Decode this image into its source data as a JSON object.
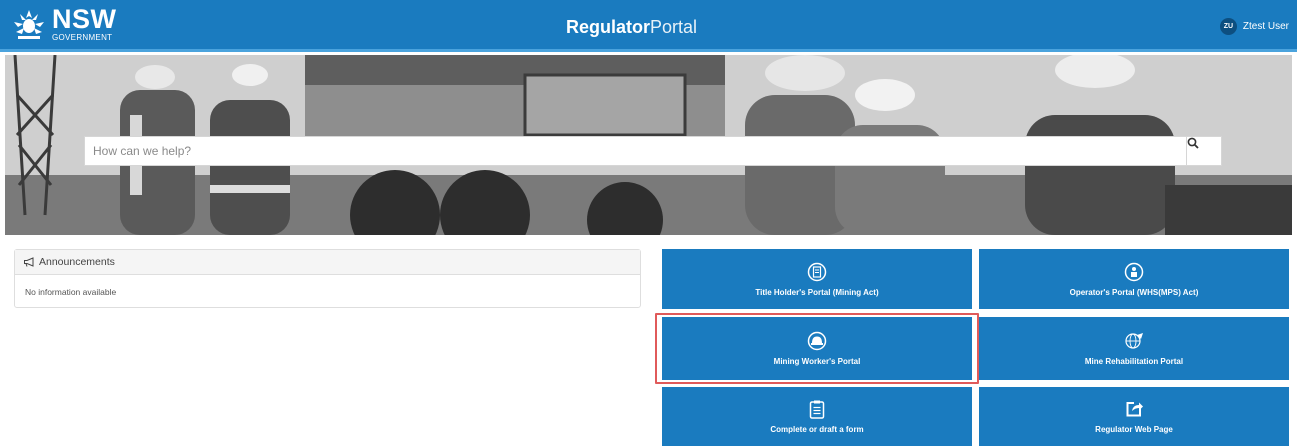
{
  "header": {
    "logo_main": "NSW",
    "logo_sub": "GOVERNMENT",
    "brand_bold": "Regulator",
    "brand_light": "Portal",
    "user_initials": "ZU",
    "user_name": "Ztest User"
  },
  "search": {
    "placeholder": "How can we help?"
  },
  "announcements": {
    "title": "Announcements",
    "empty_text": "No information available"
  },
  "tiles": [
    {
      "label": "Title Holder's Portal (Mining Act)",
      "icon": "title-holder-icon"
    },
    {
      "label": "Operator's Portal (WHS(MPS) Act)",
      "icon": "operator-icon"
    },
    {
      "label": "Mining Worker's Portal",
      "icon": "hard-hat-icon"
    },
    {
      "label": "Mine Rehabilitation Portal",
      "icon": "nsw-globe-icon"
    },
    {
      "label": "Complete or draft a form",
      "icon": "clipboard-icon"
    },
    {
      "label": "Regulator Web Page",
      "icon": "share-icon"
    }
  ],
  "colors": {
    "primary": "#1a7bbf",
    "highlight": "#e05a5a"
  }
}
